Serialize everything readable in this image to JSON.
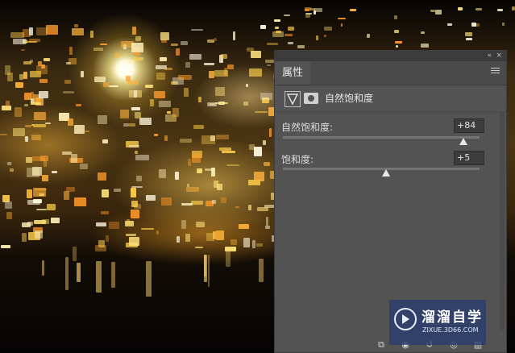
{
  "panel": {
    "tab_label": "属性",
    "collapse_glyph": "«",
    "close_glyph": "×",
    "adjustment_title": "自然饱和度",
    "vibrance": {
      "label": "自然饱和度:",
      "value": "+84",
      "level": 84,
      "range": [
        -100,
        100
      ]
    },
    "saturation": {
      "label": "饱和度:",
      "value": "+5",
      "level": 5,
      "range": [
        -100,
        100
      ]
    },
    "bottom_icons": [
      "clip-to-layer-icon",
      "view-previous-state-icon",
      "reset-icon",
      "visibility-eye-icon",
      "delete-trash-icon"
    ]
  },
  "watermark": {
    "title": "溜溜自学",
    "url": "ZIXUE.3D66.COM"
  },
  "colors": {
    "panel_bg": "#535353",
    "panel_header": "#3b3b3b",
    "field_bg": "#3c3c3c",
    "watermark_bg": "#28406e"
  }
}
